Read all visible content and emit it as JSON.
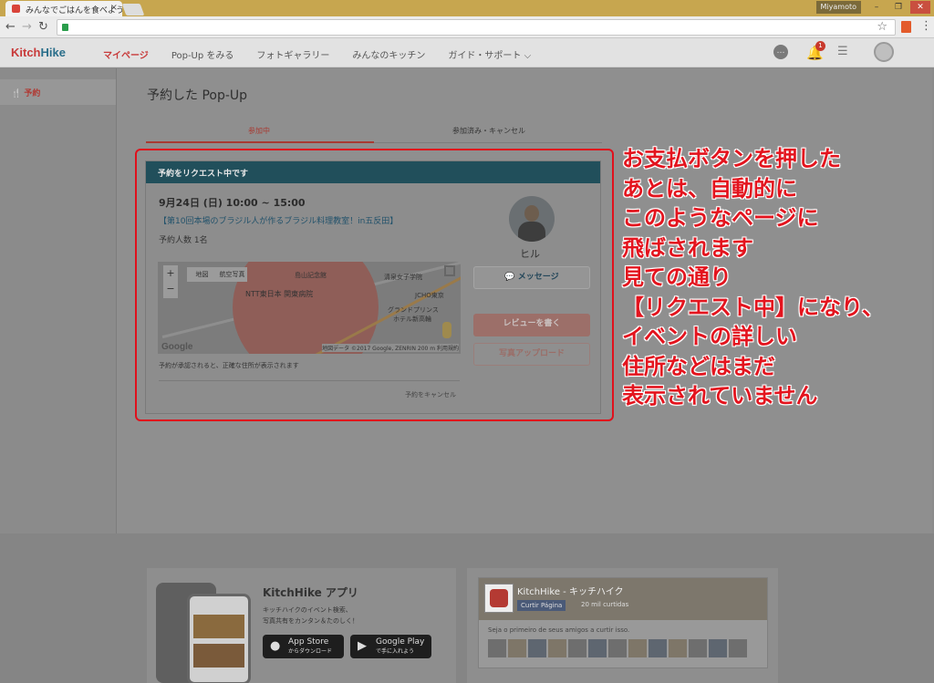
{
  "browser": {
    "tab_title": "みんなでごはんを食べよう！会",
    "profile": "Miyamoto",
    "win_min": "–",
    "win_max": "❐",
    "win_close": "✕"
  },
  "header": {
    "logo_main": "Kitch",
    "logo_accent": "Hike",
    "nav": [
      "マイページ",
      "Pop-Up をみる",
      "フォトギャラリー",
      "みんなのキッチン",
      "ガイド・サポート ⌵"
    ],
    "notification_count": "1"
  },
  "sidebar": {
    "items": [
      {
        "icon": "🍴",
        "label": "予約"
      }
    ]
  },
  "main": {
    "title": "予約した Pop-Up",
    "tabs": [
      {
        "label": "参加中",
        "active": true
      },
      {
        "label": "参加済み・キャンセル",
        "active": false
      }
    ],
    "card": {
      "header": "予約をリクエスト中です",
      "date": "9月24日 (日) 10:00 ~ 15:00",
      "event_title": "【第10回本場のブラジル人が作るブラジル料理教室！in五反田】",
      "count": "予約人数 1名",
      "map": {
        "zoom_in": "+",
        "zoom_out": "−",
        "type_map": "地図",
        "type_satellite": "航空写真",
        "labels": [
          "NTT東日本 関東病院",
          "島山記念館",
          "清泉女子学院",
          "JCHO東京",
          "グランドプリンス",
          "ホテル新高輪"
        ],
        "google": "Google",
        "attribution": "地図データ ©2017 Google, ZENRIN  200 m  利用規約"
      },
      "note": "予約が承認されると、正確な住所が表示されます",
      "cancel": "予約をキャンセル",
      "host_name": "ヒル",
      "buttons": {
        "message": "メッセージ",
        "review": "レビューを書く",
        "photo": "写真アップロード"
      }
    }
  },
  "annotation": {
    "lines": [
      "お支払ボタンを押した",
      "あとは、自動的に",
      "このようなページに",
      "飛ばされます",
      "見ての通り",
      "【リクエスト中】になり、",
      "イベントの詳しい",
      "住所などはまだ",
      "表示されていません"
    ],
    "color": "#e3141e"
  },
  "footer": {
    "app": {
      "title": "KitchHike アプリ",
      "desc1": "キッチハイクのイベント検索、",
      "desc2": "写真共有をカンタン＆たのしく！",
      "appstore_main": "App Store",
      "appstore_sub": "からダウンロード",
      "gplay_main": "Google Play",
      "gplay_sub": "で手に入れよう"
    },
    "fb": {
      "page_name": "KitchHike - キッチハイク",
      "like": "Curtir Página",
      "likes": "20 mil curtidas",
      "text": "Seja o primeiro de seus amigos a curtir isso."
    }
  }
}
